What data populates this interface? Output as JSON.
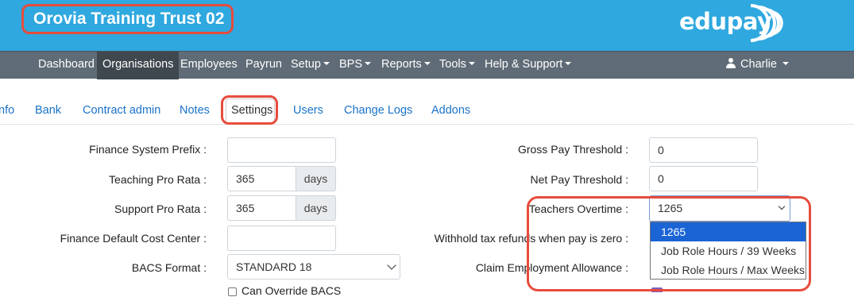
{
  "header": {
    "org_title": "Orovia Training Trust 02",
    "logo_text_1": "edu",
    "logo_text_2": "pay"
  },
  "nav": {
    "items": [
      {
        "label": "Dashboard"
      },
      {
        "label": "Organisations"
      },
      {
        "label": "Employees"
      },
      {
        "label": "Payrun"
      },
      {
        "label": "Setup"
      },
      {
        "label": "BPS"
      },
      {
        "label": "Reports"
      },
      {
        "label": "Tools"
      },
      {
        "label": "Help & Support"
      }
    ],
    "user": "Charlie"
  },
  "tabs": [
    {
      "label": "nfo"
    },
    {
      "label": "Bank"
    },
    {
      "label": "Contract admin"
    },
    {
      "label": "Notes"
    },
    {
      "label": "Settings"
    },
    {
      "label": "Users"
    },
    {
      "label": "Change Logs"
    },
    {
      "label": "Addons"
    }
  ],
  "form_left": {
    "finance_prefix": {
      "label": "Finance System Prefix :",
      "value": ""
    },
    "teaching_pro_rata": {
      "label": "Teaching Pro Rata :",
      "value": "365",
      "unit": "days"
    },
    "support_pro_rata": {
      "label": "Support Pro Rata :",
      "value": "365",
      "unit": "days"
    },
    "finance_cost_center": {
      "label": "Finance Default Cost Center :",
      "value": ""
    },
    "bacs_format": {
      "label": "BACS Format :",
      "value": "STANDARD 18"
    },
    "can_override_bacs": {
      "label": "Can Override BACS"
    }
  },
  "form_right": {
    "gross_pay_threshold": {
      "label": "Gross Pay Threshold :",
      "value": "0"
    },
    "net_pay_threshold": {
      "label": "Net Pay Threshold :",
      "value": "0"
    },
    "teachers_overtime": {
      "label": "Teachers Overtime :",
      "value": "1265",
      "options": [
        "1265",
        "Job Role Hours / 39 Weeks",
        "Job Role Hours / Max Weeks"
      ]
    },
    "withhold_tax": {
      "label": "Withhold tax refunds when pay is zero :"
    },
    "claim_employment_allowance": {
      "label": "Claim Employment Allowance :"
    }
  },
  "colors": {
    "banner": "#2fa8df",
    "nav": "#5f6b76",
    "highlight": "#e74c3c",
    "link": "#1a73c8",
    "selected_option": "#1a64d6"
  }
}
